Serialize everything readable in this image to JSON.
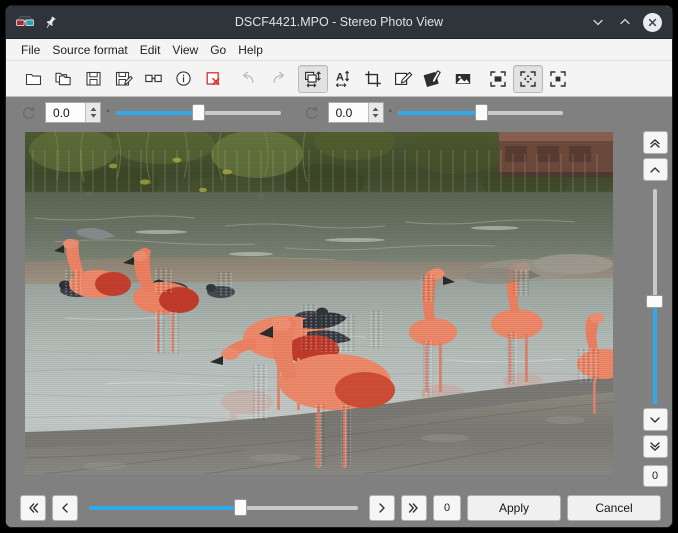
{
  "window": {
    "title": "DSCF4421.MPO - Stereo Photo View",
    "app_icon": "anaglyph-glasses-icon",
    "pin_icon": "pin-icon",
    "controls": {
      "minimize": "chevron-down-icon",
      "maximize": "chevron-up-icon",
      "close": "close-icon"
    },
    "colors": {
      "titlebar_bg": "#2f343b",
      "titlebar_text": "#dfe3e7",
      "chrome_bg": "#f4f4f4",
      "canvas_bg": "#808080",
      "accent": "#31a9e8"
    }
  },
  "menubar": {
    "items": [
      {
        "label": "File"
      },
      {
        "label": "Source format"
      },
      {
        "label": "Edit"
      },
      {
        "label": "View"
      },
      {
        "label": "Go"
      },
      {
        "label": "Help"
      }
    ]
  },
  "toolbar": {
    "buttons": [
      {
        "name": "open-file-icon",
        "enabled": true,
        "active": false
      },
      {
        "name": "open-folder-icon",
        "enabled": true,
        "active": false
      },
      {
        "name": "save-icon",
        "enabled": true,
        "active": false
      },
      {
        "name": "save-as-icon",
        "enabled": true,
        "active": false
      },
      {
        "name": "stereo-pair-icon",
        "enabled": true,
        "active": false
      },
      {
        "name": "info-icon",
        "enabled": true,
        "active": false
      },
      {
        "name": "delete-icon",
        "enabled": true,
        "active": false
      },
      {
        "name": "undo-icon",
        "enabled": false,
        "active": false
      },
      {
        "name": "redo-icon",
        "enabled": true,
        "active": false
      },
      {
        "name": "align-images-icon",
        "enabled": true,
        "active": true
      },
      {
        "name": "auto-align-text-icon",
        "enabled": true,
        "active": false
      },
      {
        "name": "crop-icon",
        "enabled": true,
        "active": false
      },
      {
        "name": "edit-left-image-icon",
        "enabled": true,
        "active": false
      },
      {
        "name": "edit-right-image-icon",
        "enabled": true,
        "active": false
      },
      {
        "name": "image-icon",
        "enabled": true,
        "active": false
      },
      {
        "name": "fit-window-icon",
        "enabled": true,
        "active": false
      },
      {
        "name": "fit-content-icon",
        "enabled": true,
        "active": true
      },
      {
        "name": "actual-size-icon",
        "enabled": true,
        "active": false
      }
    ]
  },
  "adjust_bar": {
    "left": {
      "reset_icon": "rotate-reset-icon",
      "value": "0.0",
      "unit": "°",
      "slider_percent": 50
    },
    "right": {
      "reset_icon": "rotate-reset-icon",
      "value": "0.0",
      "unit": "°",
      "slider_percent": 50
    }
  },
  "vertical_panel": {
    "top_buttons": [
      {
        "name": "double-chevron-up-icon",
        "glyph": "«"
      },
      {
        "name": "chevron-up-icon",
        "glyph": "‹"
      }
    ],
    "slider_percent": 52,
    "bottom_buttons": [
      {
        "name": "chevron-down-icon",
        "glyph": "›"
      },
      {
        "name": "double-chevron-down-icon",
        "glyph": "»"
      }
    ],
    "value": "0"
  },
  "bottom_bar": {
    "first_button": {
      "name": "skip-back-button",
      "glyph": "«"
    },
    "prev_button": {
      "name": "step-back-button",
      "glyph": "‹"
    },
    "slider_percent": 56,
    "next_button": {
      "name": "step-forward-button",
      "glyph": "›"
    },
    "last_button": {
      "name": "skip-forward-button",
      "glyph": "»"
    },
    "value": "0",
    "apply_label": "Apply",
    "cancel_label": "Cancel"
  },
  "photo": {
    "description": "Stereoscopic anaglyph photograph of flamingos wading in a zoo pond with ducks, concrete rim and green foliage reflections",
    "alt": "flamingos-stereo-photo"
  }
}
